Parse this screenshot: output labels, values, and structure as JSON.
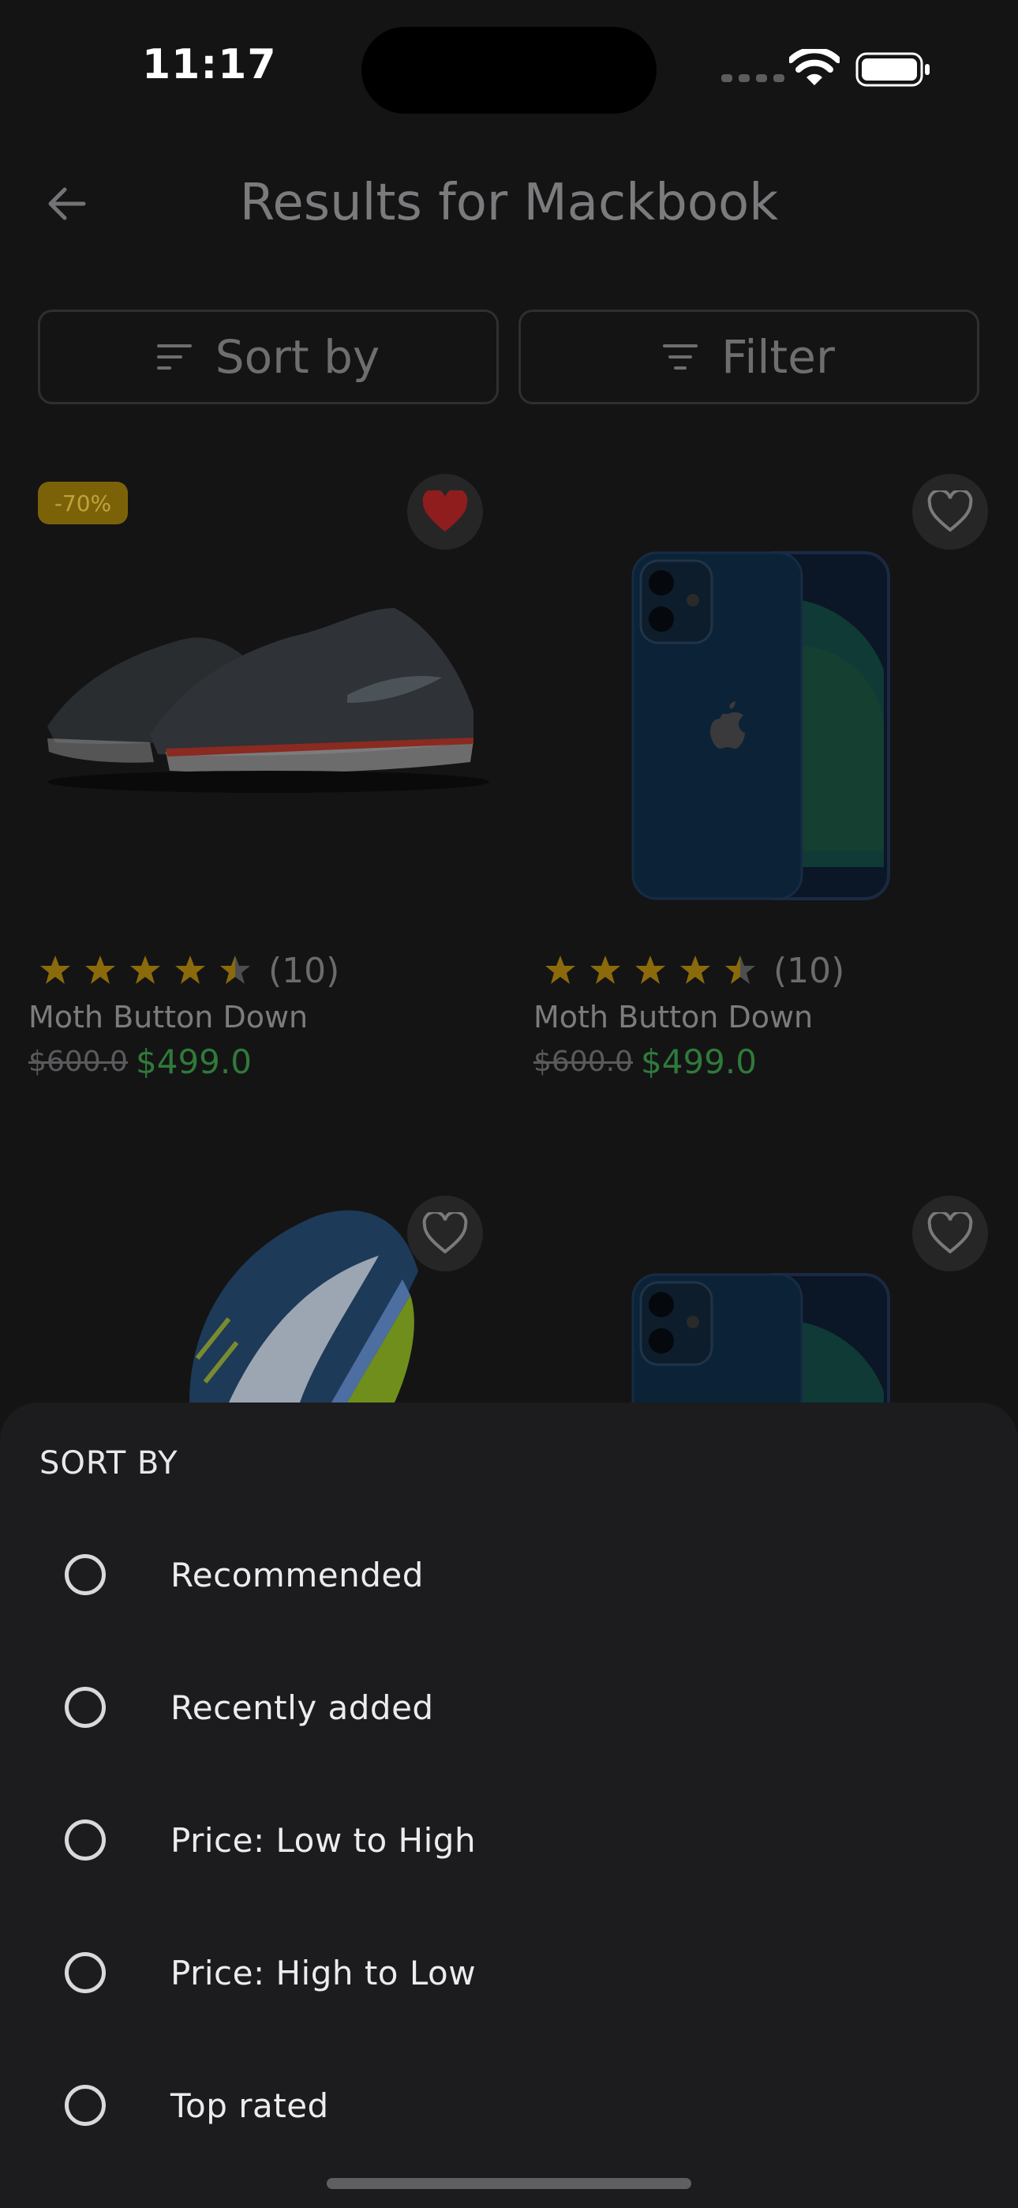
{
  "status_bar": {
    "time": "11:17"
  },
  "header": {
    "title": "Results for Mackbook"
  },
  "toolbar": {
    "sort_label": "Sort by",
    "filter_label": "Filter"
  },
  "products": [
    {
      "badge": "-70%",
      "favorite": true,
      "rating": 4.5,
      "reviews": "(10)",
      "name": "Moth Button Down",
      "old_price": "$600.0",
      "price": "$499.0"
    },
    {
      "favorite": false,
      "rating": 4.5,
      "reviews": "(10)",
      "name": "Moth Button Down",
      "old_price": "$600.0",
      "price": "$499.0"
    }
  ],
  "sort_sheet": {
    "title": "SORT BY",
    "options": [
      "Recommended",
      "Recently added",
      "Price: Low to High",
      "Price: High to Low",
      "Top rated"
    ]
  },
  "colors": {
    "accent_badge": "#7b6209",
    "price_green": "#2f7a3a",
    "favorite_red": "#8f1d1d",
    "star": "#8a6a0a",
    "sheet_bg": "#1c1c1e"
  }
}
